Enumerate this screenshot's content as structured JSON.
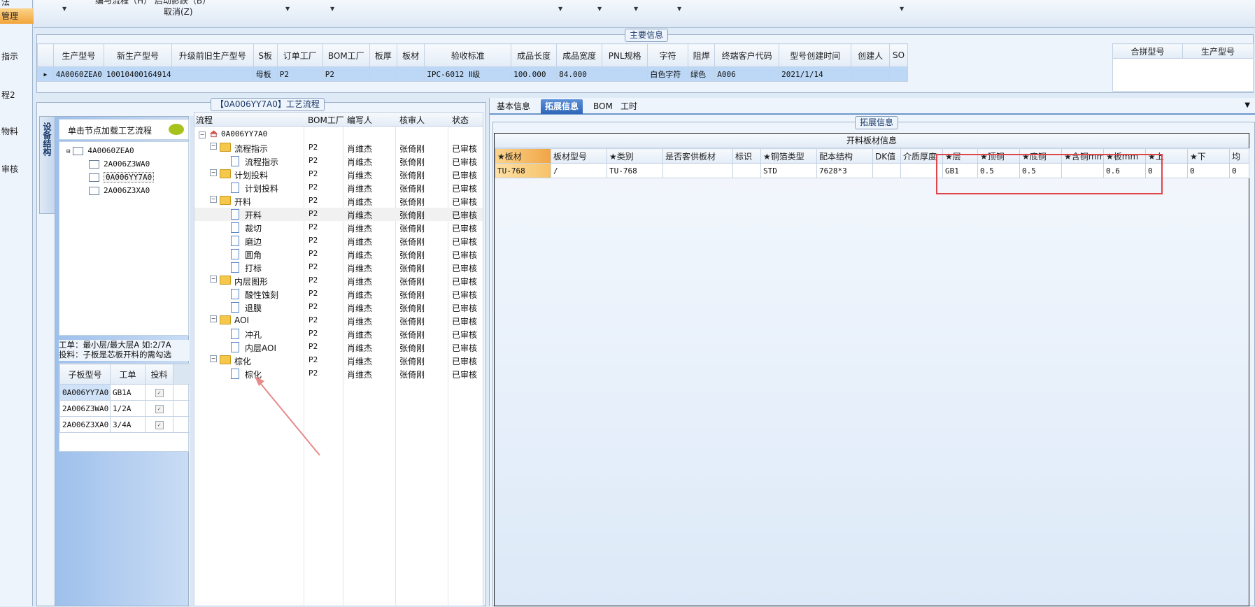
{
  "left_nav": {
    "items": [
      "法",
      "管理",
      "指示",
      "",
      "程2",
      "",
      "物料",
      "",
      "审核"
    ]
  },
  "toolbar": {
    "line1": "编与流程（H）  启动影跌（B）",
    "cancel": "取消(Z)"
  },
  "main_info": {
    "title": "主要信息",
    "columns": [
      "生产型号",
      "新生产型号",
      "升级前旧生产型号",
      "S板",
      "订单工厂",
      "BOM工厂",
      "板厚",
      "板材",
      "验收标准",
      "成品长度",
      "成品宽度",
      "PNL规格",
      "字符",
      "阻焊",
      "终端客户代码",
      "型号创建时间",
      "创建人",
      "SO"
    ],
    "row": [
      "4A0060ZEA0",
      "10010400164914",
      "",
      "母板",
      "P2",
      "P2",
      "",
      "",
      "IPC-6012 Ⅱ级",
      "100.000",
      "84.000",
      "",
      "白色字符",
      "绿色",
      "A006",
      "2021/1/14",
      "",
      ""
    ],
    "merge_columns": [
      "合拼型号",
      "生产型号"
    ]
  },
  "flow_panel": {
    "title": "【0A006YY7A0】工艺流程",
    "side_tab": "设备结构",
    "struct_header": "单击节点加载工艺流程",
    "struct_tree": [
      "4A0060ZEA0",
      "2A006Z3WA0",
      "0A006YY7A0",
      "2A006Z3XA0"
    ],
    "note_line1": "工单：最小层/最大层A 如:2/7A",
    "note_line2": "投料：子板是芯板开料的需勾选",
    "sub_columns": [
      "子板型号",
      "工单",
      "投料"
    ],
    "sub_rows": [
      [
        "0A006YY7A0",
        "GB1A",
        "✓"
      ],
      [
        "2A006Z3WA0",
        "1/2A",
        "✓"
      ],
      [
        "2A006Z3XA0",
        "3/4A",
        "✓"
      ]
    ],
    "flow_columns": [
      "流程",
      "BOM工厂",
      "编写人",
      "核审人",
      "状态"
    ],
    "flow_root": "0A006YY7A0",
    "flow_rows": [
      {
        "name": "流程指示",
        "bom": "P2",
        "writer": "肖维杰",
        "reviewer": "张倚刚",
        "status": "已审核"
      },
      {
        "name": "流程指示",
        "bom": "P2",
        "writer": "肖维杰",
        "reviewer": "张倚刚",
        "status": "已审核"
      },
      {
        "name": "计划投料",
        "bom": "P2",
        "writer": "肖维杰",
        "reviewer": "张倚刚",
        "status": "已审核"
      },
      {
        "name": "计划投料",
        "bom": "P2",
        "writer": "肖维杰",
        "reviewer": "张倚刚",
        "status": "已审核"
      },
      {
        "name": "开料",
        "bom": "P2",
        "writer": "肖维杰",
        "reviewer": "张倚刚",
        "status": "已审核"
      },
      {
        "name": "开料",
        "bom": "P2",
        "writer": "肖维杰",
        "reviewer": "张倚刚",
        "status": "已审核"
      },
      {
        "name": "裁切",
        "bom": "P2",
        "writer": "肖维杰",
        "reviewer": "张倚刚",
        "status": "已审核"
      },
      {
        "name": "磨边",
        "bom": "P2",
        "writer": "肖维杰",
        "reviewer": "张倚刚",
        "status": "已审核"
      },
      {
        "name": "圆角",
        "bom": "P2",
        "writer": "肖维杰",
        "reviewer": "张倚刚",
        "status": "已审核"
      },
      {
        "name": "打标",
        "bom": "P2",
        "writer": "肖维杰",
        "reviewer": "张倚刚",
        "status": "已审核"
      },
      {
        "name": "内层图形",
        "bom": "P2",
        "writer": "肖维杰",
        "reviewer": "张倚刚",
        "status": "已审核"
      },
      {
        "name": "酸性蚀刻",
        "bom": "P2",
        "writer": "肖维杰",
        "reviewer": "张倚刚",
        "status": "已审核"
      },
      {
        "name": "退膜",
        "bom": "P2",
        "writer": "肖维杰",
        "reviewer": "张倚刚",
        "status": "已审核"
      },
      {
        "name": "AOI",
        "bom": "P2",
        "writer": "肖维杰",
        "reviewer": "张倚刚",
        "status": "已审核"
      },
      {
        "name": "冲孔",
        "bom": "P2",
        "writer": "肖维杰",
        "reviewer": "张倚刚",
        "status": "已审核"
      },
      {
        "name": "内层AOI",
        "bom": "P2",
        "writer": "肖维杰",
        "reviewer": "张倚刚",
        "status": "已审核"
      },
      {
        "name": "棕化",
        "bom": "P2",
        "writer": "肖维杰",
        "reviewer": "张倚刚",
        "status": "已审核"
      },
      {
        "name": "棕化",
        "bom": "P2",
        "writer": "肖维杰",
        "reviewer": "张倚刚",
        "status": "已审核"
      }
    ]
  },
  "right_panel": {
    "tabs": [
      "基本信息",
      "拓展信息",
      "BOM",
      "工时"
    ],
    "active_tab": "拓展信息",
    "group_title": "拓展信息",
    "table_title": "开料板材信息",
    "columns": [
      "★板材",
      "板材型号",
      "★类别",
      "是否客供板材",
      "标识",
      "★铜箔类型",
      "配本结构",
      "DK值",
      "介质厚度",
      "★层",
      "★顶铜",
      "★底铜",
      "★含铜mm",
      "★板mm",
      "★上",
      "★下",
      "均"
    ],
    "row": [
      "TU-768",
      "/",
      "TU-768",
      "",
      "",
      "STD",
      "7628*3",
      "",
      "",
      "GB1",
      "0.5",
      "0.5",
      "",
      "0.6",
      "0",
      "0",
      "0"
    ]
  },
  "colors": {
    "highlight_box": "#e0454a",
    "arrow": "#e88a8a",
    "active_tab": "#3a72c4",
    "selected_row": "#bcd8f6"
  }
}
